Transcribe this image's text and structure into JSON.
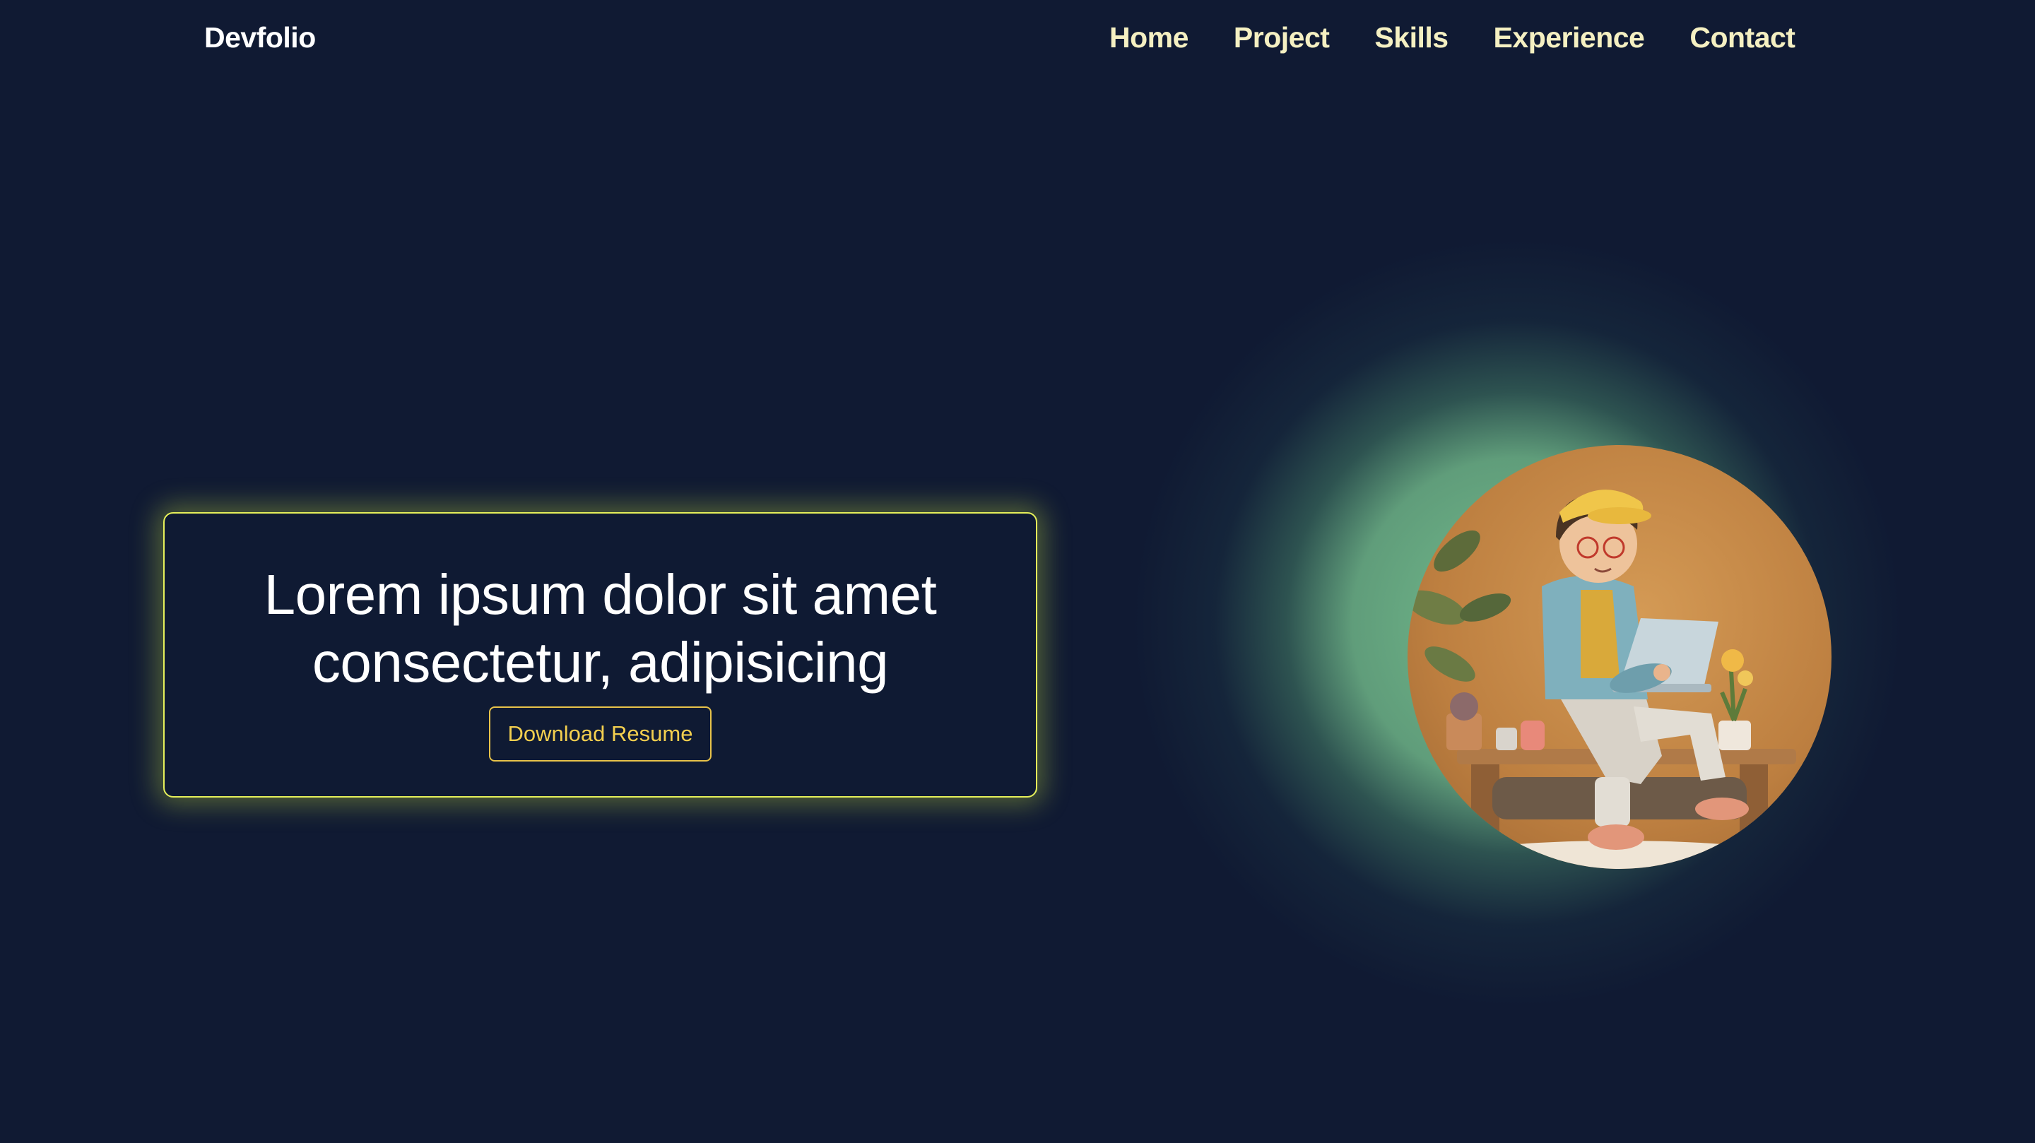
{
  "header": {
    "brand": "Devfolio",
    "nav": [
      "Home",
      "Project",
      "Skills",
      "Experience",
      "Contact"
    ]
  },
  "hero": {
    "title": "Lorem ipsum dolor sit amet consectetur, adipisicing",
    "button_label": "Download Resume"
  },
  "avatar": {
    "icon": "developer-avatar-illustration"
  },
  "colors": {
    "background": "#101a33",
    "nav_text": "#f5f0c2",
    "card_border": "#e6f05a",
    "button_accent": "#f3cf4f",
    "glow": "#78c491"
  }
}
